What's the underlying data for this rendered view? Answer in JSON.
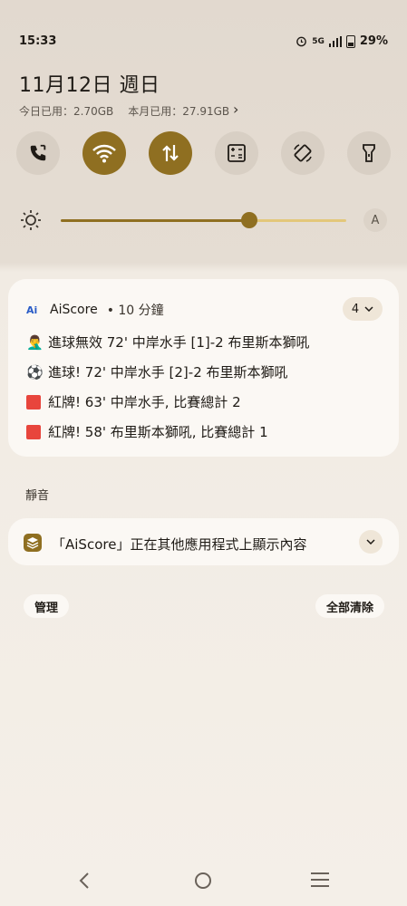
{
  "status_bar": {
    "time": "15:33",
    "network": "5G",
    "battery": "29%",
    "icons": [
      "alarm-icon",
      "signal-icon",
      "battery-icon"
    ]
  },
  "header": {
    "date": "11月12日 週日",
    "today_usage": "今日已用：2.70GB",
    "month_usage": "本月已用：27.91GB"
  },
  "quick_settings": [
    {
      "name": "call-icon",
      "active": false
    },
    {
      "name": "wifi-icon",
      "active": true
    },
    {
      "name": "data-icon",
      "active": true
    },
    {
      "name": "calculator-icon",
      "active": false
    },
    {
      "name": "rotate-icon",
      "active": false
    },
    {
      "name": "flashlight-icon",
      "active": false
    }
  ],
  "brightness": {
    "level": 0.66,
    "auto_label": "A"
  },
  "notification": {
    "app_name": "AiScore",
    "app_logo": "Ai",
    "time": "• 10 分鐘",
    "count": "4",
    "lines": [
      {
        "icon": "🤦‍♂️",
        "text": "進球無效 72' 中岸水手 [1]-2 布里斯本獅吼"
      },
      {
        "icon": "⚽",
        "text": "進球! 72' 中岸水手 [2]-2 布里斯本獅吼"
      },
      {
        "icon": "red-card",
        "text": "紅牌! 63' 中岸水手, 比賽總計 2"
      },
      {
        "icon": "red-card",
        "text": "紅牌! 58' 布里斯本獅吼, 比賽總計 1"
      }
    ]
  },
  "silent_section": {
    "header": "靜音",
    "text": "「AiScore」正在其他應用程式上顯示內容"
  },
  "buttons": {
    "manage": "管理",
    "clear_all": "全部清除"
  },
  "colors": {
    "accent": "#8f6f21",
    "accent_light": "#e3c77a",
    "card_bg": "#fbf8f4",
    "red_card": "#e8453c"
  }
}
